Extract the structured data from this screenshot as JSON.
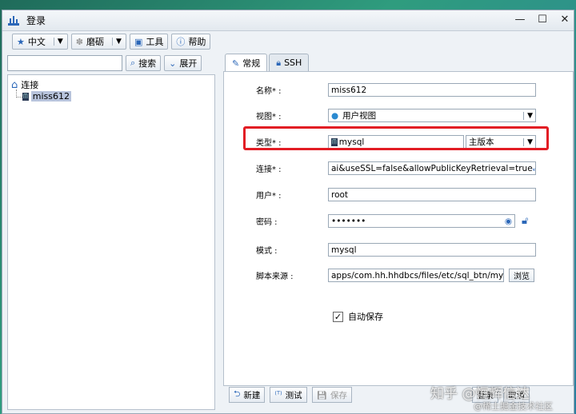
{
  "window": {
    "title": "登录"
  },
  "toolbar": {
    "language": "中文",
    "theme": "磨砺",
    "tools": "工具",
    "help": "帮助"
  },
  "search": {
    "value": "",
    "button": "搜索",
    "expand": "展开"
  },
  "tree": {
    "root": "连接",
    "child": "miss612"
  },
  "tabs": [
    {
      "label": "常规"
    },
    {
      "label": "SSH"
    }
  ],
  "form": {
    "name_label": "名称* :",
    "name_value": "miss612",
    "view_label": "视图* :",
    "view_value": "用户视图",
    "type_label": "类型* :",
    "type_value": "mysql",
    "version_value": "主版本",
    "conn_label": "连接* :",
    "conn_value": "ai&useSSL=false&allowPublicKeyRetrieval=true",
    "user_label": "用户* :",
    "user_value": "root",
    "pwd_label": "密码 :",
    "pwd_value": "•••••••",
    "schema_label": "模式 :",
    "schema_value": "mysql",
    "script_label": "脚本来源 :",
    "script_value": "apps/com.hh.hhdbcs/files/etc/sql_btn/mysql",
    "browse": "浏览",
    "autosave": "自动保存"
  },
  "buttons": {
    "new": "新建",
    "test": "测试",
    "save": "保存",
    "login": "登录",
    "cancel": "取消"
  },
  "watermark": {
    "line1": "知乎 @恒辉信达",
    "line2": "@稀土掘金技术社区"
  },
  "colors": {
    "highlight": "#e21c24",
    "accent": "#2b67b8"
  }
}
